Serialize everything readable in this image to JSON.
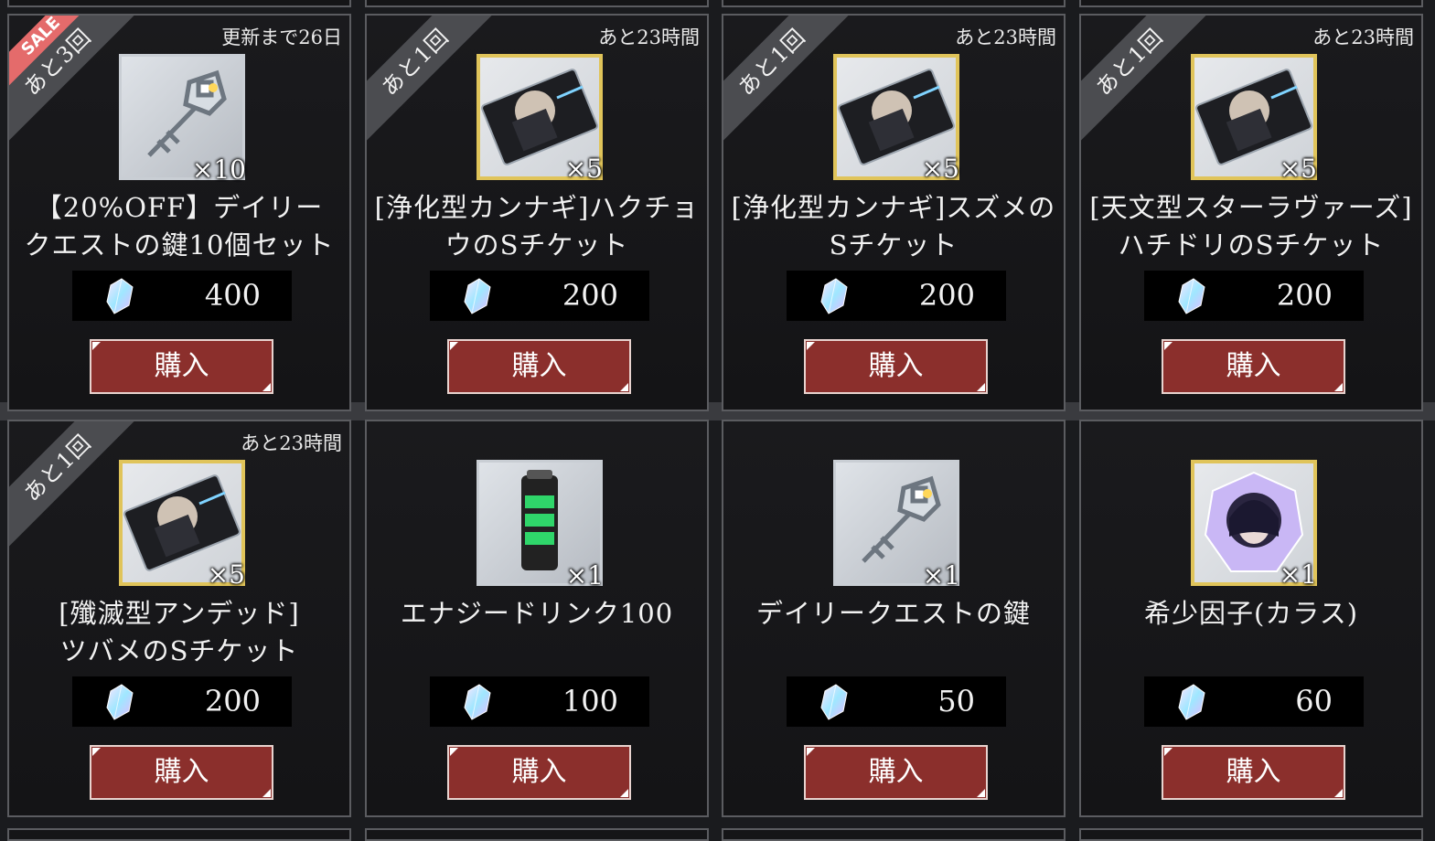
{
  "buy_label": "購入",
  "items": [
    {
      "badge": "あと3回",
      "sale": "SALE",
      "timer": "更新まで26日",
      "icon": "key-icon",
      "frame": "silver",
      "qty": "×10",
      "name": "【20%OFF】デイリー\nクエストの鍵10個セット",
      "price": "400"
    },
    {
      "badge": "あと1回",
      "sale": "",
      "timer": "あと23時間",
      "icon": "ticket-icon",
      "frame": "gold",
      "qty": "×5",
      "name": "[浄化型カンナギ]ハクチョ\nウのSチケット",
      "price": "200"
    },
    {
      "badge": "あと1回",
      "sale": "",
      "timer": "あと23時間",
      "icon": "ticket-icon",
      "frame": "gold",
      "qty": "×5",
      "name": "[浄化型カンナギ]スズメの\nSチケット",
      "price": "200"
    },
    {
      "badge": "あと1回",
      "sale": "",
      "timer": "あと23時間",
      "icon": "ticket-icon",
      "frame": "gold",
      "qty": "×5",
      "name": "[天文型スターラヴァーズ]\nハチドリのSチケット",
      "price": "200"
    },
    {
      "badge": "あと1回",
      "sale": "",
      "timer": "あと23時間",
      "icon": "ticket-icon",
      "frame": "gold",
      "qty": "×5",
      "name": "[殲滅型アンデッド]\nツバメのSチケット",
      "price": "200"
    },
    {
      "badge": "",
      "sale": "",
      "timer": "",
      "icon": "energy-drink-icon",
      "frame": "silver",
      "qty": "×1",
      "name": "エナジードリンク100",
      "price": "100"
    },
    {
      "badge": "",
      "sale": "",
      "timer": "",
      "icon": "key-icon",
      "frame": "silver",
      "qty": "×1",
      "name": "デイリークエストの鍵",
      "price": "50"
    },
    {
      "badge": "",
      "sale": "",
      "timer": "",
      "icon": "crystal-factor-icon",
      "frame": "gold",
      "qty": "×1",
      "name": "希少因子(カラス)",
      "price": "60"
    }
  ],
  "colors": {
    "button": "#8b2f2c",
    "sale": "#e46b6b",
    "gold_frame": "#e0c45a"
  }
}
